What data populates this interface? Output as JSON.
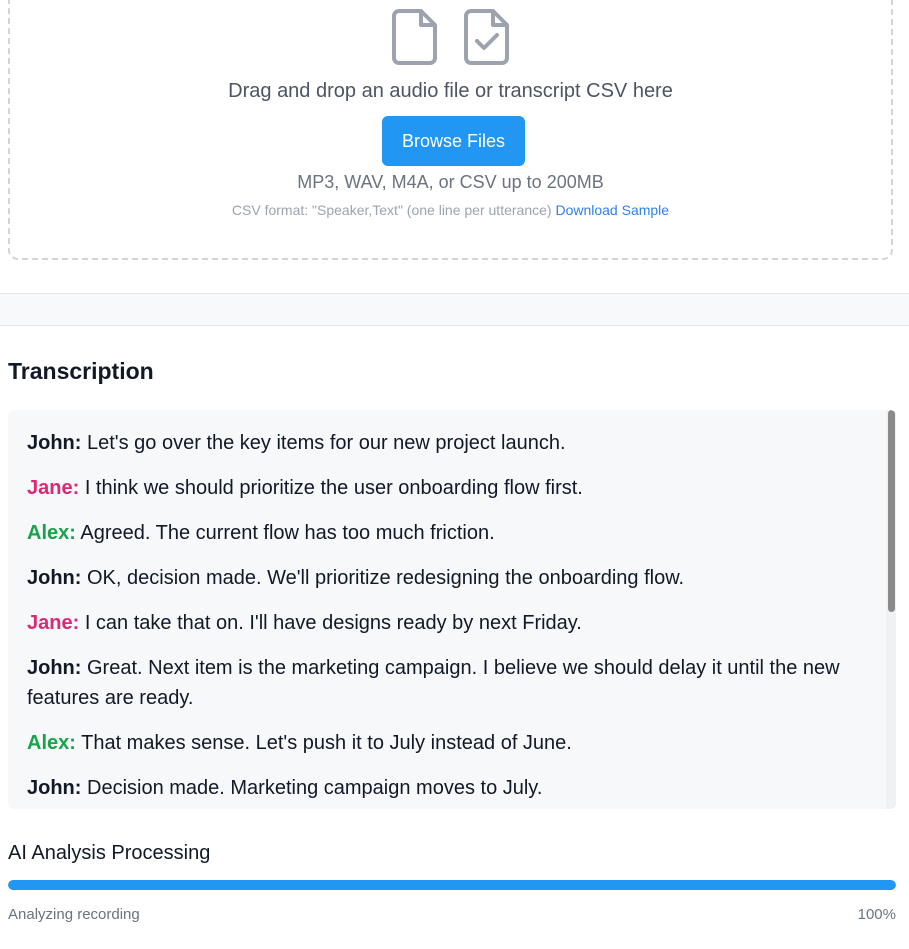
{
  "upload": {
    "prompt": "Drag and drop an audio file or transcript CSV here",
    "browse_label": "Browse Files",
    "formats": "MP3, WAV, M4A, or CSV up to 200MB",
    "csv_format_note": "CSV format: \"Speaker,Text\" (one line per utterance)",
    "download_sample_label": "Download Sample",
    "icons": [
      "file-icon",
      "file-check-icon"
    ]
  },
  "transcription": {
    "title": "Transcription",
    "speaker_colors": {
      "John": "#111827",
      "Jane": "#db2777",
      "Alex": "#16a34a"
    },
    "utterances": [
      {
        "speaker": "John:",
        "text": "Let's go over the key items for our new project launch."
      },
      {
        "speaker": "Jane:",
        "text": "I think we should prioritize the user onboarding flow first."
      },
      {
        "speaker": "Alex:",
        "text": "Agreed. The current flow has too much friction."
      },
      {
        "speaker": "John:",
        "text": "OK, decision made. We'll prioritize redesigning the onboarding flow."
      },
      {
        "speaker": "Jane:",
        "text": "I can take that on. I'll have designs ready by next Friday."
      },
      {
        "speaker": "John:",
        "text": "Great. Next item is the marketing campaign. I believe we should delay it until the new features are ready."
      },
      {
        "speaker": "Alex:",
        "text": "That makes sense. Let's push it to July instead of June."
      },
      {
        "speaker": "John:",
        "text": "Decision made. Marketing campaign moves to July."
      }
    ]
  },
  "analysis": {
    "label": "AI Analysis Processing",
    "status": "Analyzing recording",
    "percent_label": "100%",
    "progress": 1.0,
    "accent_color": "#2196f3"
  }
}
